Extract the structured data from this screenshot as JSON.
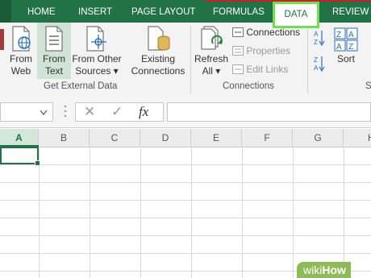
{
  "tabs": [
    {
      "label": "HOME"
    },
    {
      "label": "INSERT"
    },
    {
      "label": "PAGE LAYOUT"
    },
    {
      "label": "FORMULAS"
    },
    {
      "label": "DATA",
      "active": true
    },
    {
      "label": "REVIEW"
    }
  ],
  "ribbon": {
    "from_web": {
      "line1": "From",
      "line2": "Web"
    },
    "from_text": {
      "line1": "From",
      "line2": "Text"
    },
    "from_other": {
      "line1": "From Other",
      "line2": "Sources ▾"
    },
    "existing": {
      "line1": "Existing",
      "line2": "Connections"
    },
    "refresh": {
      "line1": "Refresh",
      "line2": "All ▾"
    },
    "connections": "Connections",
    "properties": "Properties",
    "edit_links": "Edit Links",
    "sort": "Sort",
    "group_get_external": "Get External Data",
    "group_connections": "Connections",
    "group_clipped": "S"
  },
  "formula_bar": {
    "cancel_glyph": "✕",
    "enter_glyph": "✓",
    "fx_label": "fx"
  },
  "grid": {
    "columns": [
      "A",
      "B",
      "C",
      "D",
      "E",
      "F",
      "G",
      "H"
    ],
    "selected_column": "A"
  },
  "watermark": {
    "prefix": "wiki",
    "suffix": "How"
  },
  "colors": {
    "excel_green": "#217346",
    "highlight_green": "#6ee04f",
    "accent_red": "#c81d25"
  }
}
